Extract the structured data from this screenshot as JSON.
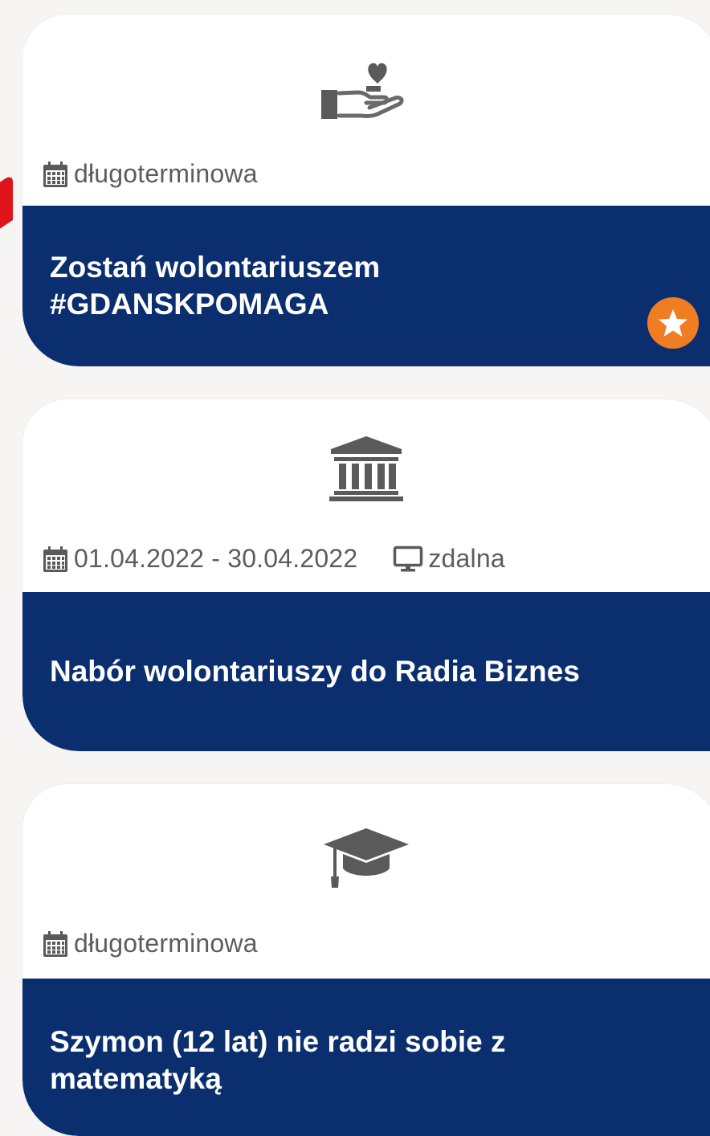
{
  "cards": [
    {
      "icon": "hand-heart-icon",
      "meta": [
        {
          "icon": "calendar-icon",
          "text": "długoterminowa"
        }
      ],
      "title_line1": "Zostań wolontariuszem",
      "title_line2": "#GDANSKPOMAGA",
      "favorite_icon": "star-icon",
      "colors": {
        "band": "#0b2f6e",
        "favorite": "#f07d22"
      }
    },
    {
      "icon": "institution-icon",
      "meta": [
        {
          "icon": "calendar-icon",
          "text": "01.04.2022 - 30.04.2022"
        },
        {
          "icon": "monitor-icon",
          "text": "zdalna"
        }
      ],
      "title_line1": "Nabór wolontariuszy do Radia Biznes"
    },
    {
      "icon": "graduation-cap-icon",
      "meta": [
        {
          "icon": "calendar-icon",
          "text": "długoterminowa"
        }
      ],
      "title_line1": "Szymon (12 lat) nie radzi sobie z",
      "title_line2": "matematyką"
    }
  ]
}
